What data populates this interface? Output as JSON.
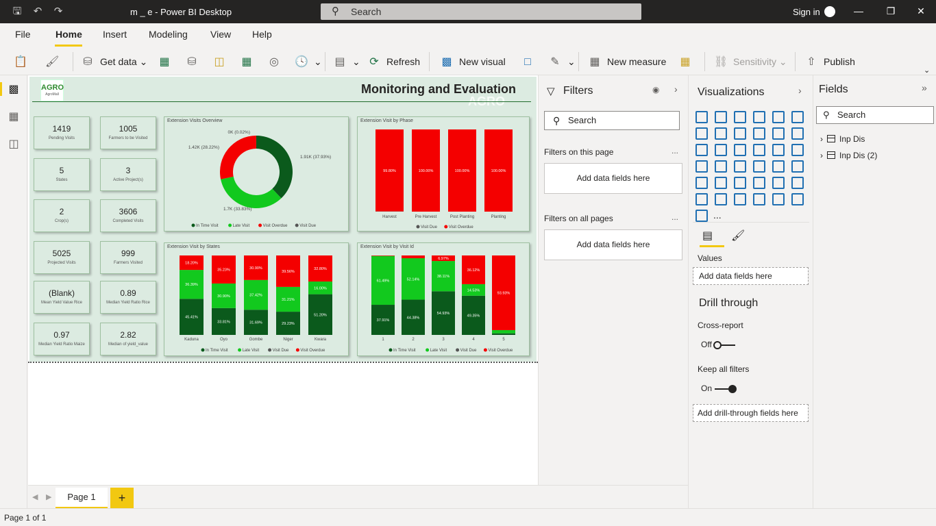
{
  "window": {
    "title": "m _ e - Power BI Desktop",
    "search": "Search",
    "sign_in": "Sign in"
  },
  "menu": [
    "File",
    "Home",
    "Insert",
    "Modeling",
    "View",
    "Help"
  ],
  "ribbon": {
    "get_data": "Get data",
    "refresh": "Refresh",
    "new_visual": "New visual",
    "new_measure": "New measure",
    "sensitivity": "Sensitivity",
    "publish": "Publish"
  },
  "report": {
    "title": "Monitoring and Evaluation",
    "logo_text": "AGRO",
    "logo_sub": "AgroMall",
    "watermark": "AGRO",
    "kpis": [
      {
        "value": "1419",
        "label": "Pending Visits"
      },
      {
        "value": "1005",
        "label": "Farmers to be Visited"
      },
      {
        "value": "5",
        "label": "States"
      },
      {
        "value": "3",
        "label": "Active Project(s)"
      },
      {
        "value": "2",
        "label": "Crop(s)"
      },
      {
        "value": "3606",
        "label": "Completed Visits"
      },
      {
        "value": "5025",
        "label": "Projected Visits"
      },
      {
        "value": "999",
        "label": "Farmers Visited"
      },
      {
        "value": "(Blank)",
        "label": "Mean Yield Value Rice"
      },
      {
        "value": "0.89",
        "label": "Median Yield Ratio Rice"
      },
      {
        "value": "0.97",
        "label": "Median Yield Ratio Maize"
      },
      {
        "value": "2.82",
        "label": "Median of yield_value"
      }
    ]
  },
  "colors": {
    "dark_green": "#0b5a1c",
    "green": "#12c91e",
    "red": "#f40000",
    "grey": "#555555"
  },
  "chart_data": [
    {
      "type": "pie",
      "title": "Extension Visits Overview",
      "categories": [
        "In Time Visit",
        "Late Visit",
        "Visit Overdue",
        "Visit Due"
      ],
      "values": [
        37.93,
        33.83,
        28.22,
        0.02
      ],
      "data_labels": [
        "1.91K (37.93%)",
        "1.7K (33.83%)",
        "1.42K (28.22%)",
        "0K (0.02%)"
      ],
      "colors": [
        "#0b5a1c",
        "#12c91e",
        "#f40000",
        "#555555"
      ],
      "legend": "bottom"
    },
    {
      "type": "bar",
      "title": "Extension Visit by Phase",
      "categories": [
        "Harvest",
        "Pre Harvest",
        "Post Planting",
        "Planting"
      ],
      "series": [
        {
          "name": "Visit Due",
          "values": [
            0.2,
            0,
            0,
            0
          ],
          "color": "#555555"
        },
        {
          "name": "Visit Overdue",
          "values": [
            99.8,
            100,
            100,
            100
          ],
          "color": "#f40000"
        }
      ],
      "labels": [
        "99.80%",
        "100.00%",
        "100.00%",
        "100.00%"
      ],
      "ylim": [
        0,
        100
      ],
      "legend": "bottom"
    },
    {
      "type": "bar",
      "title": "Extension Visit by States",
      "categories": [
        "Kaduna",
        "Oyo",
        "Gombe",
        "Niger",
        "Kwara"
      ],
      "series": [
        {
          "name": "In Time Visit",
          "values": [
            45.41,
            33.81,
            31.69,
            29.23,
            51.2
          ],
          "labels": [
            "45.41%",
            "33.81%",
            "31.69%",
            "29.23%",
            "51.20%"
          ],
          "color": "#0b5a1c"
        },
        {
          "name": "Late Visit",
          "values": [
            36.39,
            30.9,
            37.42,
            31.21,
            16.0
          ],
          "labels": [
            "36.39%",
            "30.90%",
            "37.42%",
            "31.21%",
            "16.00%"
          ],
          "color": "#12c91e"
        },
        {
          "name": "Visit Due",
          "values": [
            0,
            0,
            0,
            0,
            0
          ],
          "labels": [
            "",
            "",
            "",
            "",
            ""
          ],
          "color": "#555555"
        },
        {
          "name": "Visit Overdue",
          "values": [
            18.2,
            35.23,
            30.9,
            39.56,
            32.8
          ],
          "labels": [
            "18.20%",
            "35.23%",
            "30.90%",
            "39.56%",
            "32.80%"
          ],
          "color": "#f40000"
        }
      ],
      "ylim": [
        0,
        100
      ],
      "legend": "bottom"
    },
    {
      "type": "bar",
      "title": "Extension Visit by Visit Id",
      "categories": [
        "1",
        "2",
        "3",
        "4",
        "5"
      ],
      "series": [
        {
          "name": "In Time Visit",
          "values": [
            37.91,
            44.38,
            54.93,
            49.35,
            2.0
          ],
          "labels": [
            "37.91%",
            "44.38%",
            "54.93%",
            "49.35%",
            ""
          ],
          "color": "#0b5a1c"
        },
        {
          "name": "Late Visit",
          "values": [
            61.49,
            52.14,
            38.11,
            14.53,
            4.07
          ],
          "labels": [
            "61.49%",
            "52.14%",
            "38.11%",
            "14.53%",
            ""
          ],
          "color": "#12c91e"
        },
        {
          "name": "Visit Due",
          "values": [
            0,
            0,
            0,
            0,
            0
          ],
          "labels": [
            "",
            "",
            "",
            "",
            ""
          ],
          "color": "#555555"
        },
        {
          "name": "Visit Overdue",
          "values": [
            0.6,
            3.48,
            6.97,
            36.12,
            93.93
          ],
          "labels": [
            "",
            "",
            "6.97%",
            "36.12%",
            "93.93%"
          ],
          "color": "#f40000"
        }
      ],
      "ylim": [
        0,
        100
      ],
      "legend": "bottom"
    }
  ],
  "filters": {
    "title": "Filters",
    "search": "Search",
    "on_page": "Filters on this page",
    "on_all": "Filters on all pages",
    "add": "Add data fields here",
    "more": "..."
  },
  "viz": {
    "title": "Visualizations",
    "values_label": "Values",
    "add_data": "Add data fields here",
    "drill": "Drill through",
    "cross_report": "Cross-report",
    "off": "Off",
    "keep_filters": "Keep all filters",
    "on": "On",
    "add_drill": "Add drill-through fields here",
    "more": "..."
  },
  "fields": {
    "title": "Fields",
    "search": "Search",
    "tables": [
      "Inp Dis",
      "Inp Dis (2)"
    ]
  },
  "pages": {
    "tab": "Page 1",
    "add": "+",
    "status": "Page 1 of 1"
  }
}
